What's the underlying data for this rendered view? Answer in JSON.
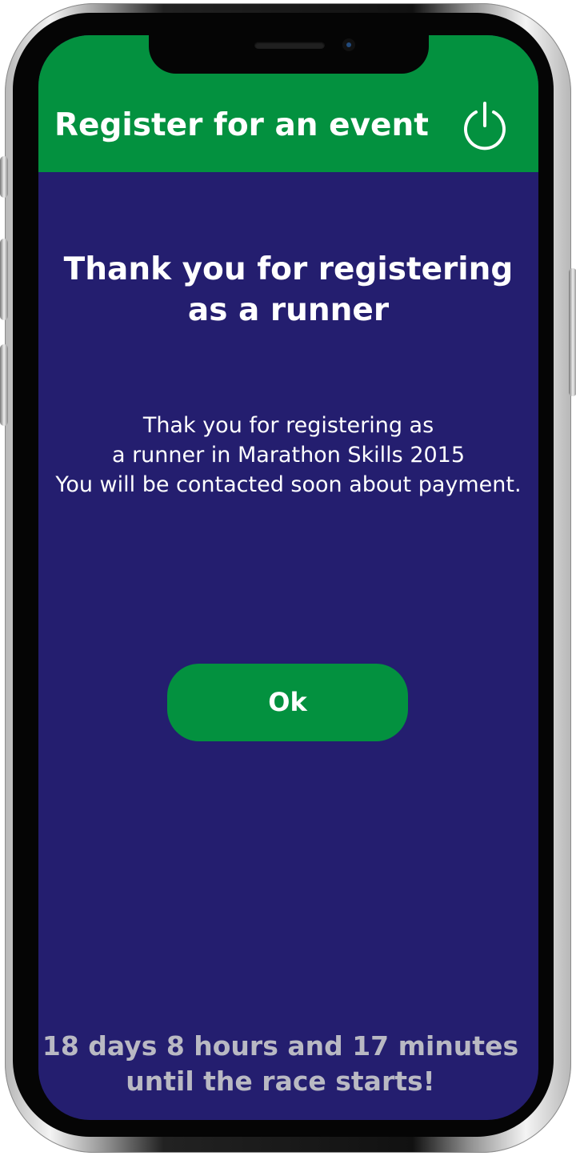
{
  "header": {
    "title": "Register for an event",
    "power_icon": "power-icon",
    "background_color": "#03913f"
  },
  "content": {
    "heading": "Thank you for registering as a runner",
    "message_lines": [
      "Thak you for registering as",
      "a runner in Marathon Skills 2015",
      "You will be contacted soon about payment."
    ],
    "ok_label": "Ok",
    "background_color": "#241e6f"
  },
  "footer": {
    "countdown_lines": [
      "18 days 8 hours and 17 minutes",
      "until the race starts!"
    ],
    "text_color": "#b9b9c3"
  },
  "device": {
    "speaker": "speaker",
    "camera": "front-camera"
  }
}
